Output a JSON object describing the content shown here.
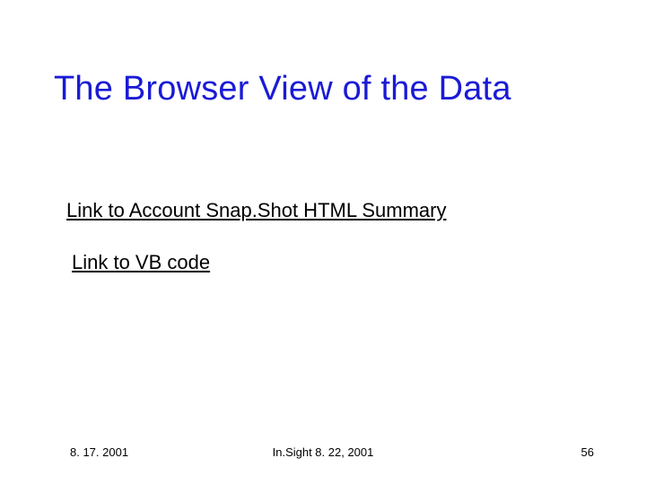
{
  "title": "The Browser View of the Data",
  "links": {
    "snapshot": "Link to Account Snap.Shot HTML Summary",
    "vbcode": "Link to VB code"
  },
  "footer": {
    "date": "8. 17. 2001",
    "center": "In.Sight 8. 22, 2001",
    "page": "56"
  }
}
